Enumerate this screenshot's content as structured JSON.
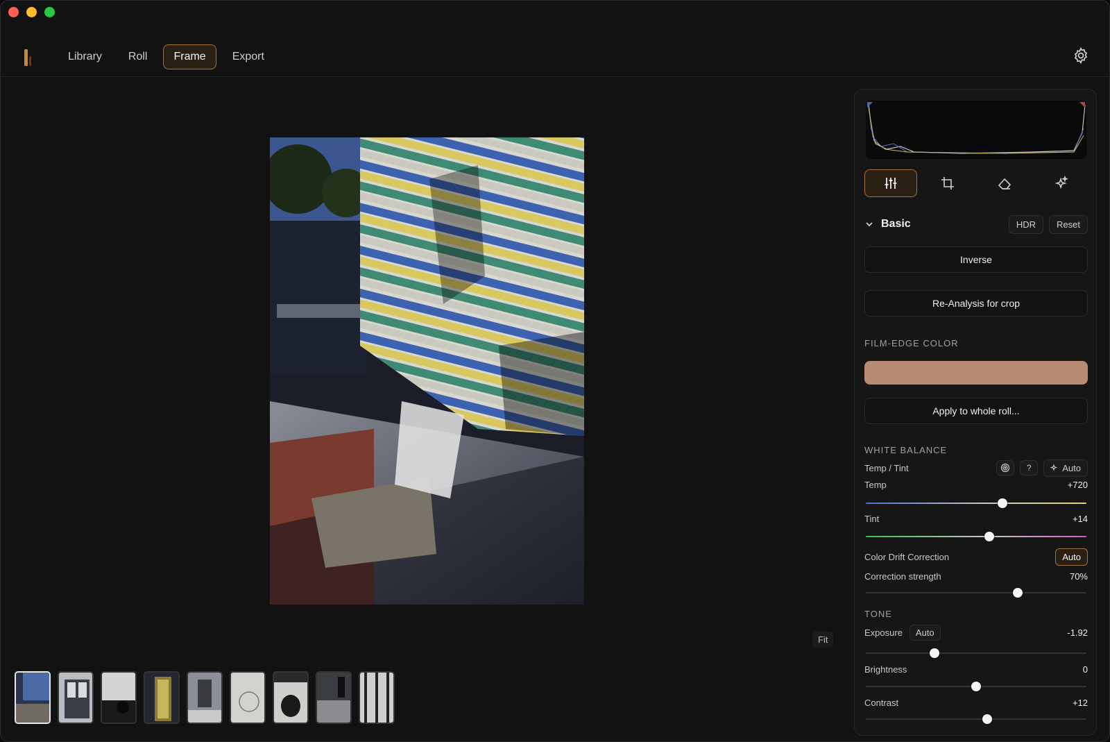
{
  "nav": {
    "tabs": [
      {
        "label": "Library"
      },
      {
        "label": "Roll"
      },
      {
        "label": "Frame",
        "active": true
      },
      {
        "label": "Export"
      }
    ]
  },
  "canvas": {
    "fit_label": "Fit"
  },
  "filmstrip": {
    "count": 9,
    "active_index": 0
  },
  "panel": {
    "section_title": "Basic",
    "hdr_label": "HDR",
    "reset_label": "Reset",
    "inverse_label": "Inverse",
    "reanalysis_label": "Re-Analysis for crop",
    "film_edge_label": "FILM-EDGE COLOR",
    "film_edge_color": "#b78c72",
    "apply_label": "Apply to whole roll...",
    "white_balance_label": "WHITE BALANCE",
    "temp_tint_label": "Temp / Tint",
    "help_label": "?",
    "wb_auto_label": "Auto",
    "temp": {
      "label": "Temp",
      "value": "+720",
      "level": 0.62
    },
    "tint": {
      "label": "Tint",
      "value": "+14",
      "level": 0.56
    },
    "drift": {
      "label": "Color Drift Correction",
      "auto_label": "Auto"
    },
    "strength": {
      "label": "Correction strength",
      "value": "70%",
      "level": 0.69
    },
    "tone_label": "TONE",
    "exposure": {
      "label": "Exposure",
      "auto_label": "Auto",
      "value": "-1.92",
      "level": 0.31
    },
    "brightness": {
      "label": "Brightness",
      "value": "0",
      "level": 0.5
    },
    "contrast": {
      "label": "Contrast",
      "value": "+12",
      "level": 0.55
    }
  },
  "colors": {
    "accent": "#a4733b",
    "accent_bg": "#2a1f13"
  }
}
